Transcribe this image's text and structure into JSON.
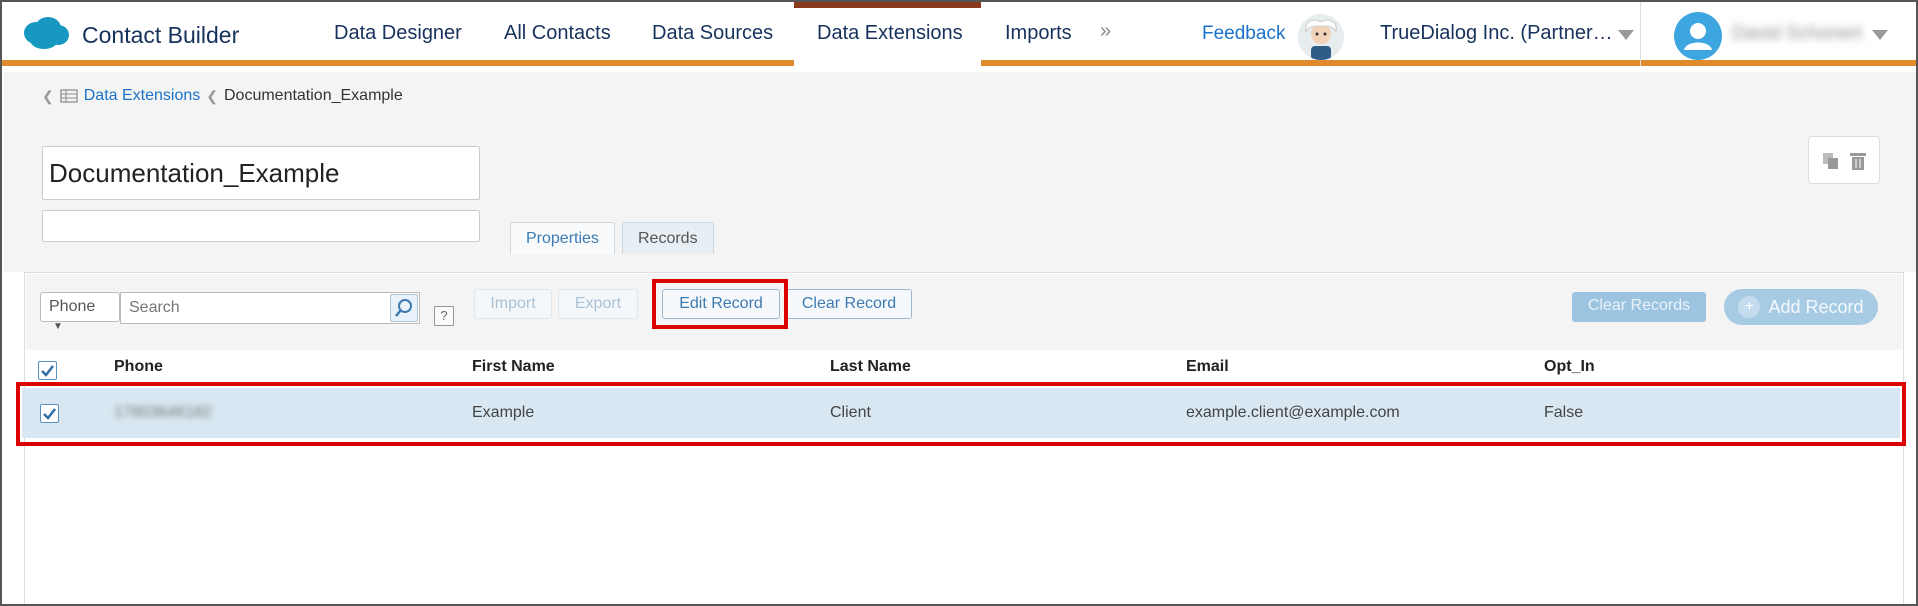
{
  "header": {
    "app_title": "Contact Builder",
    "nav": [
      "Data Designer",
      "All Contacts",
      "Data Sources",
      "Data Extensions",
      "Imports"
    ],
    "active_nav": "Data Extensions",
    "more": "»",
    "feedback": "Feedback",
    "account": "TrueDialog Inc. (Partner…",
    "username": "David Schonert"
  },
  "breadcrumb": {
    "parent": "Data Extensions",
    "current": "Documentation_Example"
  },
  "extension": {
    "name": "Documentation_Example",
    "description": ""
  },
  "tabs": [
    "Properties",
    "Records"
  ],
  "active_tab": "Records",
  "toolbar": {
    "field_select": "Phone",
    "search_placeholder": "Search",
    "help": "?",
    "import": "Import",
    "export": "Export",
    "edit_record": "Edit Record",
    "clear_record": "Clear Record",
    "clear_records": "Clear Records",
    "add_record": "Add Record"
  },
  "table": {
    "columns": [
      "Phone",
      "First Name",
      "Last Name",
      "Email",
      "Opt_In"
    ],
    "rows": [
      {
        "phone": "17803646182",
        "first_name": "Example",
        "last_name": "Client",
        "email": "example.client@example.com",
        "opt_in": "False"
      }
    ]
  },
  "colors": {
    "accent_orange": "#e08a2e",
    "highlight_red": "#dd0000",
    "link_blue": "#1a73c8"
  }
}
